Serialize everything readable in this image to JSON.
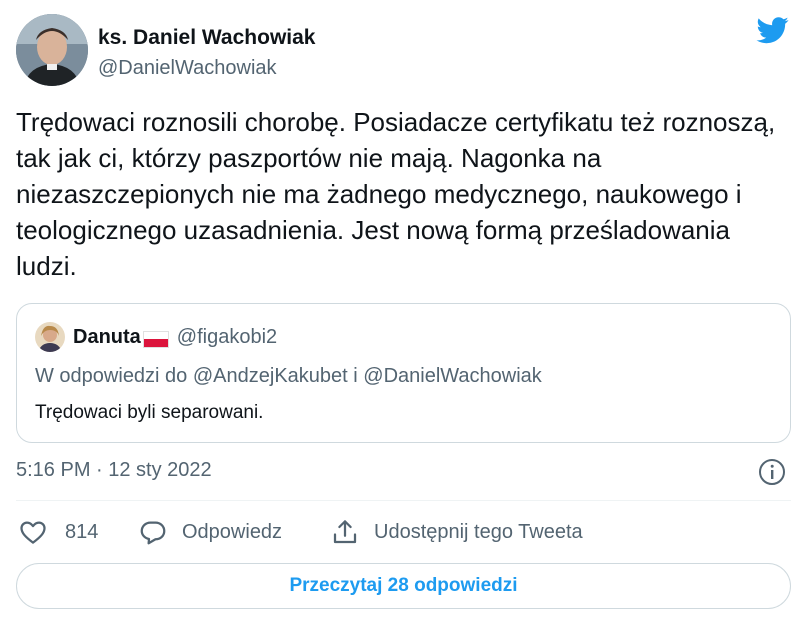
{
  "author": {
    "name": "ks. Daniel Wachowiak",
    "handle": "@DanielWachowiak"
  },
  "brand_icon": "twitter-bird-icon",
  "tweet": {
    "text": "Trędowaci roznosili chorobę. Posiadacze certyfikatu też roznoszą, tak jak ci, którzy paszportów nie mają. Nagonka na niezaszczepionych nie ma żadnego medycznego, naukowego i teologicznego uzasadnienia. Jest nową formą prześladowania ludzi."
  },
  "quote": {
    "name": "Danuta",
    "flag_icon": "poland-flag-icon",
    "handle": "@figakobi2",
    "reply_to": "W odpowiedzi do @AndzejKakubet i @DanielWachowiak",
    "text": "Trędowaci byli separowani."
  },
  "timestamp": "5:16 PM · 12 sty 2022",
  "actions": {
    "likes_count": "814",
    "reply_label": "Odpowiedz",
    "share_label": "Udostępnij tego Tweeta"
  },
  "read_replies_label": "Przeczytaj 28 odpowiedzi",
  "colors": {
    "accent": "#1d9bf0",
    "text": "#0f1419",
    "secondary": "#536471",
    "border": "#cfd9de"
  }
}
